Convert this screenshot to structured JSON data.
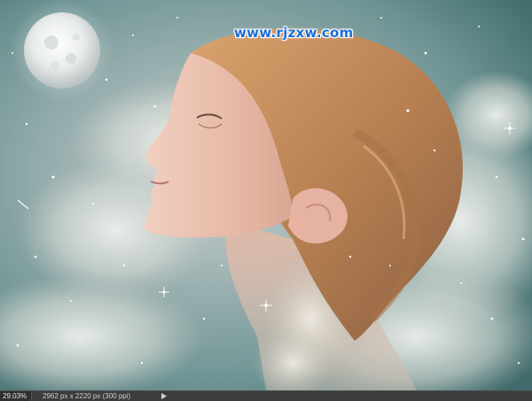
{
  "watermark": {
    "text": "www.rjzxw.com"
  },
  "statusbar": {
    "zoom": "29.03%",
    "document_info": "2962 px x 2220 px (300 ppi)"
  },
  "colors": {
    "watermark": "#1a6fd6",
    "statusbar_bg": "#3c3c3c",
    "sky_teal": "#5e8a8a"
  }
}
